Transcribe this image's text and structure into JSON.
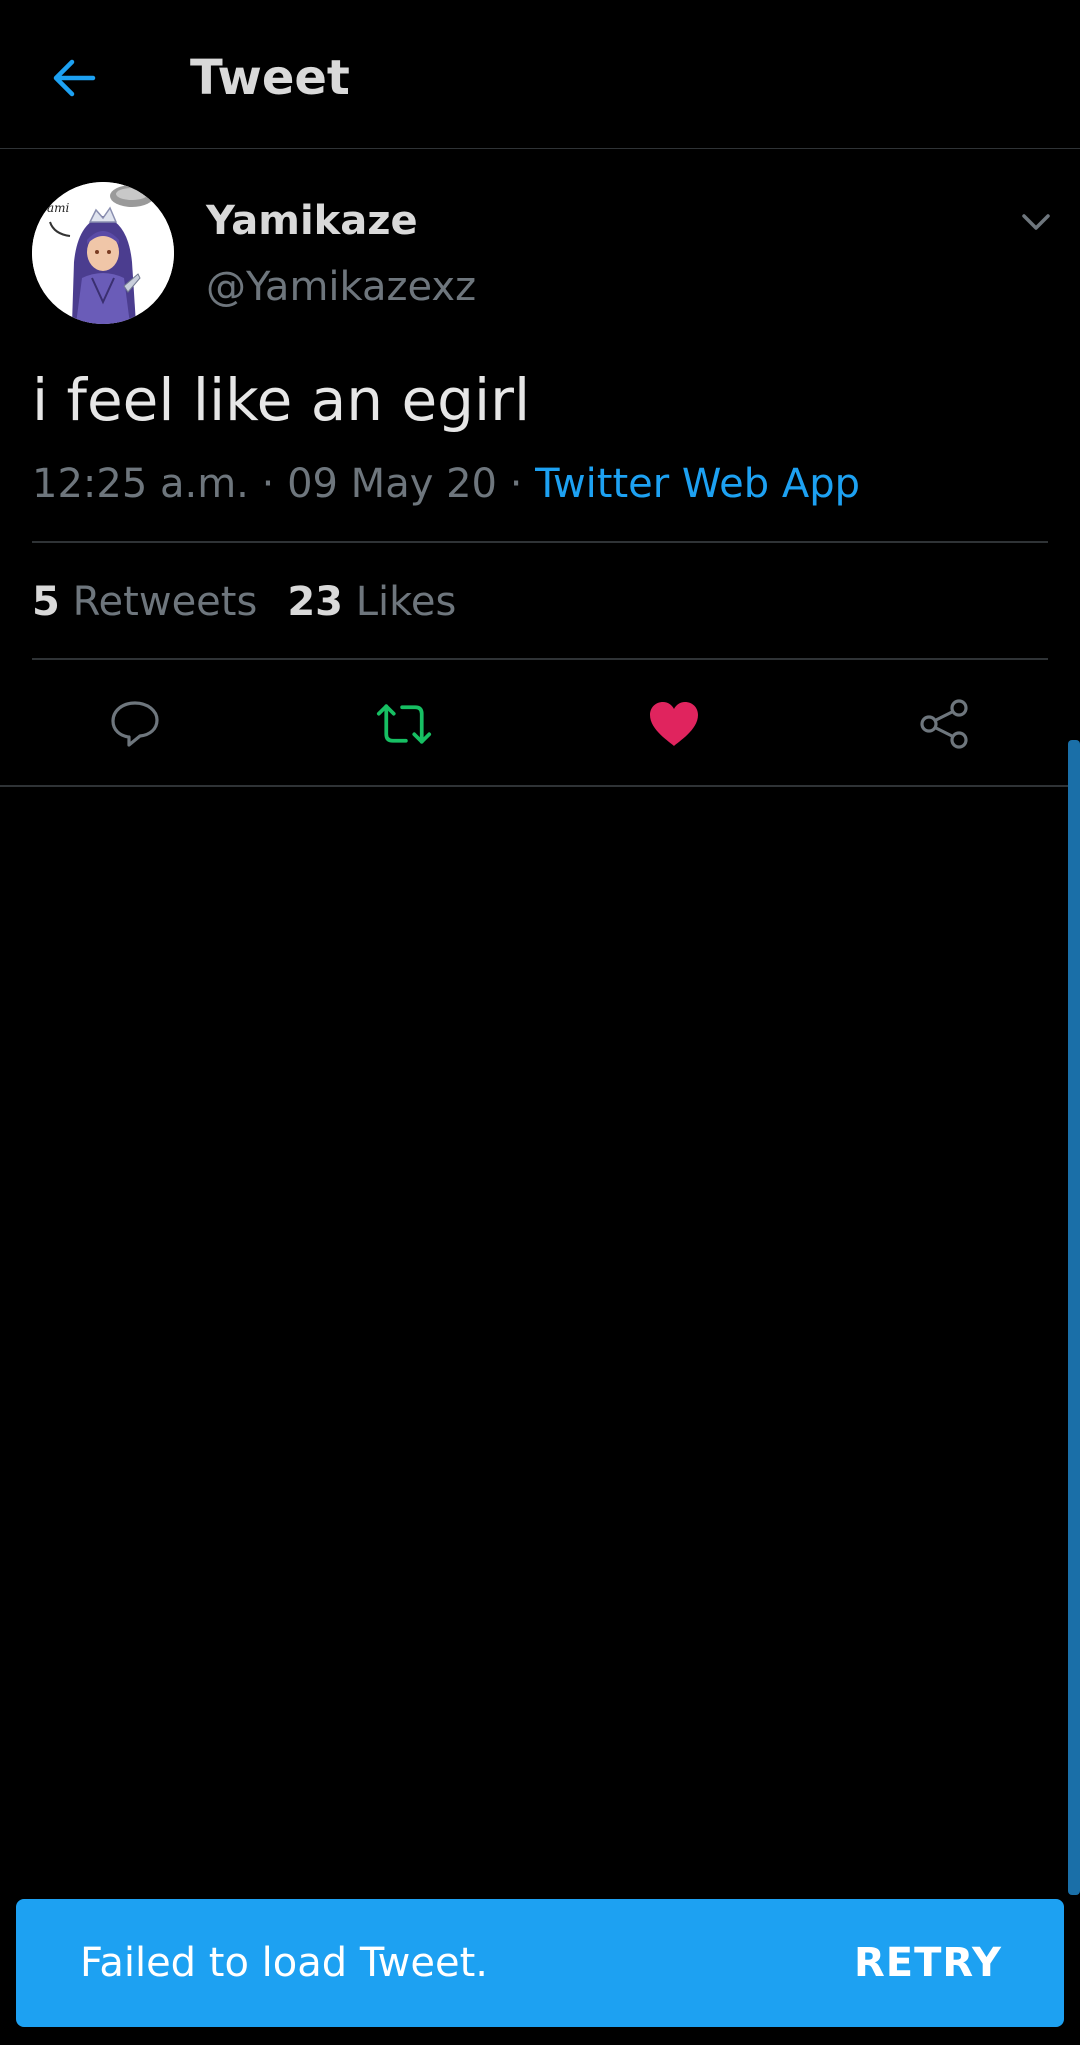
{
  "header": {
    "title": "Tweet",
    "back_icon": "arrow-left-icon"
  },
  "author": {
    "name": "Yamikaze",
    "handle": "@Yamikazexz",
    "avatar_caption": "Yami"
  },
  "tweet": {
    "text": "i feel like an egirl",
    "time": "12:25 a.m.",
    "separator": "·",
    "date": "09 May 20",
    "source": "Twitter Web App"
  },
  "stats": {
    "retweets_count": "5",
    "retweets_label": "Retweets",
    "likes_count": "23",
    "likes_label": "Likes"
  },
  "actions": {
    "reply_icon": "reply-icon",
    "retweet_icon": "retweet-icon",
    "like_icon": "heart-icon",
    "share_icon": "share-icon"
  },
  "snackbar": {
    "message": "Failed to load Tweet.",
    "action": "RETRY"
  },
  "colors": {
    "background": "#000000",
    "accent": "#1da1f2",
    "retweet_active": "#17bf63",
    "like_active": "#e0245e",
    "secondary_text": "#6e767d"
  }
}
